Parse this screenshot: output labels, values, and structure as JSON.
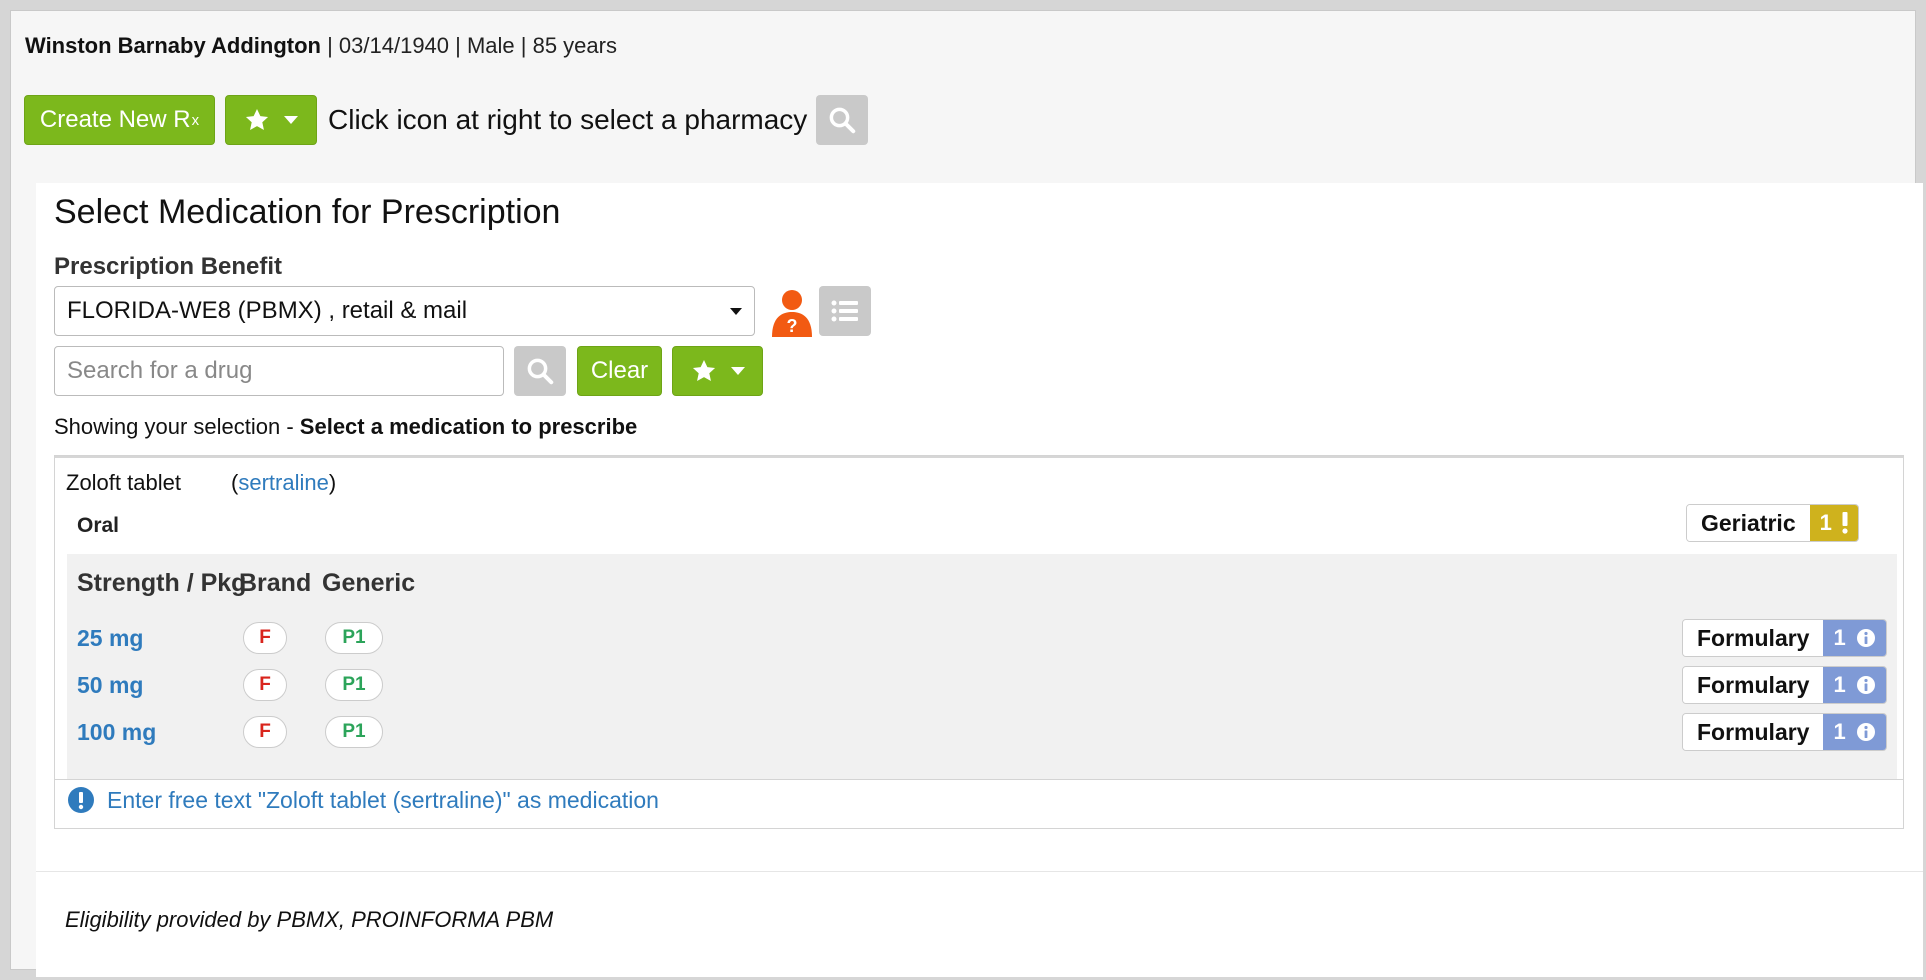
{
  "patient": {
    "name": "Winston Barnaby Addington",
    "details": "| 03/14/1940 | Male | 85 years"
  },
  "toolbar": {
    "create_label": "Create New R",
    "create_sub": "x",
    "pharmacy_text": "Click icon at right to select a pharmacy"
  },
  "panel": {
    "title": "Select Medication for Prescription",
    "benefit_label": "Prescription Benefit",
    "benefit_value": "FLORIDA-WE8 (PBMX) , retail & mail",
    "search_placeholder": "Search for a drug",
    "clear_label": "Clear",
    "showing_prefix": "Showing your selection - ",
    "showing_bold": "Select a medication to prescribe"
  },
  "drug": {
    "name": "Zoloft tablet",
    "generic_open": "(",
    "generic": "sertraline",
    "generic_close": ")",
    "route": "Oral",
    "geriatric_label": "Geriatric",
    "geriatric_count": "1",
    "headers": {
      "strength": "Strength / Pkg",
      "brand": "Brand",
      "generic": "Generic"
    },
    "rows": [
      {
        "strength": "25 mg",
        "brand": "F",
        "generic": "P1",
        "formulary_label": "Formulary",
        "formulary_count": "1"
      },
      {
        "strength": "50 mg",
        "brand": "F",
        "generic": "P1",
        "formulary_label": "Formulary",
        "formulary_count": "1"
      },
      {
        "strength": "100 mg",
        "brand": "F",
        "generic": "P1",
        "formulary_label": "Formulary",
        "formulary_count": "1"
      }
    ],
    "free_text": "Enter free text \"Zoloft tablet (sertraline)\" as medication"
  },
  "footer": {
    "eligibility": "Eligibility provided by PBMX, PROINFORMA PBM"
  },
  "colors": {
    "accent_green": "#7cb81c",
    "link_blue": "#2f7bbd",
    "geriatric_gold": "#cfb21d",
    "formulary_blue": "#7f9ad6",
    "brand_red": "#d9241c",
    "generic_green": "#2ca45a",
    "alert_orange": "#f25a12"
  },
  "icons": [
    "star-icon",
    "chevron-down-icon",
    "search-icon",
    "person-help-icon",
    "list-icon",
    "info-icon",
    "exclamation-icon"
  ]
}
